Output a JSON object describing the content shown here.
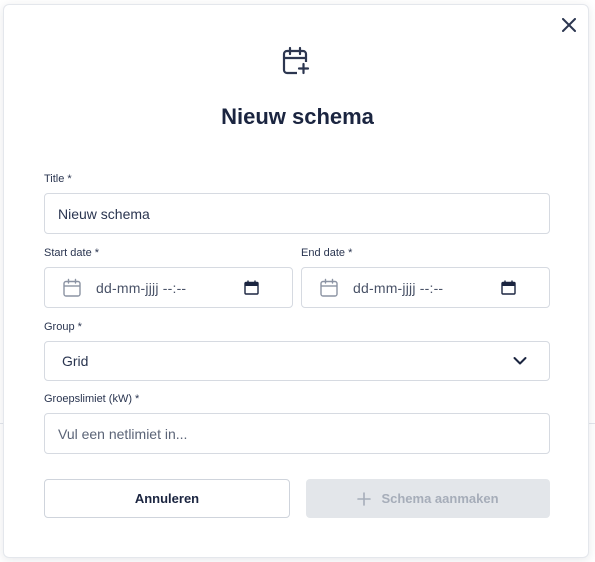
{
  "modal": {
    "title": "Nieuw schema",
    "icons": {
      "header": "calendar-plus-icon",
      "close": "close-icon"
    }
  },
  "form": {
    "title": {
      "label": "Title *",
      "value": "Nieuw schema"
    },
    "start_date": {
      "label": "Start date *",
      "value": "dd-mm-jjjj --:--"
    },
    "end_date": {
      "label": "End date *",
      "value": "dd-mm-jjjj --:--"
    },
    "group": {
      "label": "Group *",
      "selected": "Grid"
    },
    "group_limit": {
      "label": "Groepslimiet (kW) *",
      "placeholder": "Vul een netlimiet in..."
    }
  },
  "actions": {
    "cancel_label": "Annuleren",
    "create_label": "Schema aanmaken",
    "create_enabled": false
  },
  "colors": {
    "title": "#1b2540",
    "border": "#d6dae1",
    "disabled_bg": "#e3e6ea",
    "disabled_text": "#a6adb9"
  }
}
